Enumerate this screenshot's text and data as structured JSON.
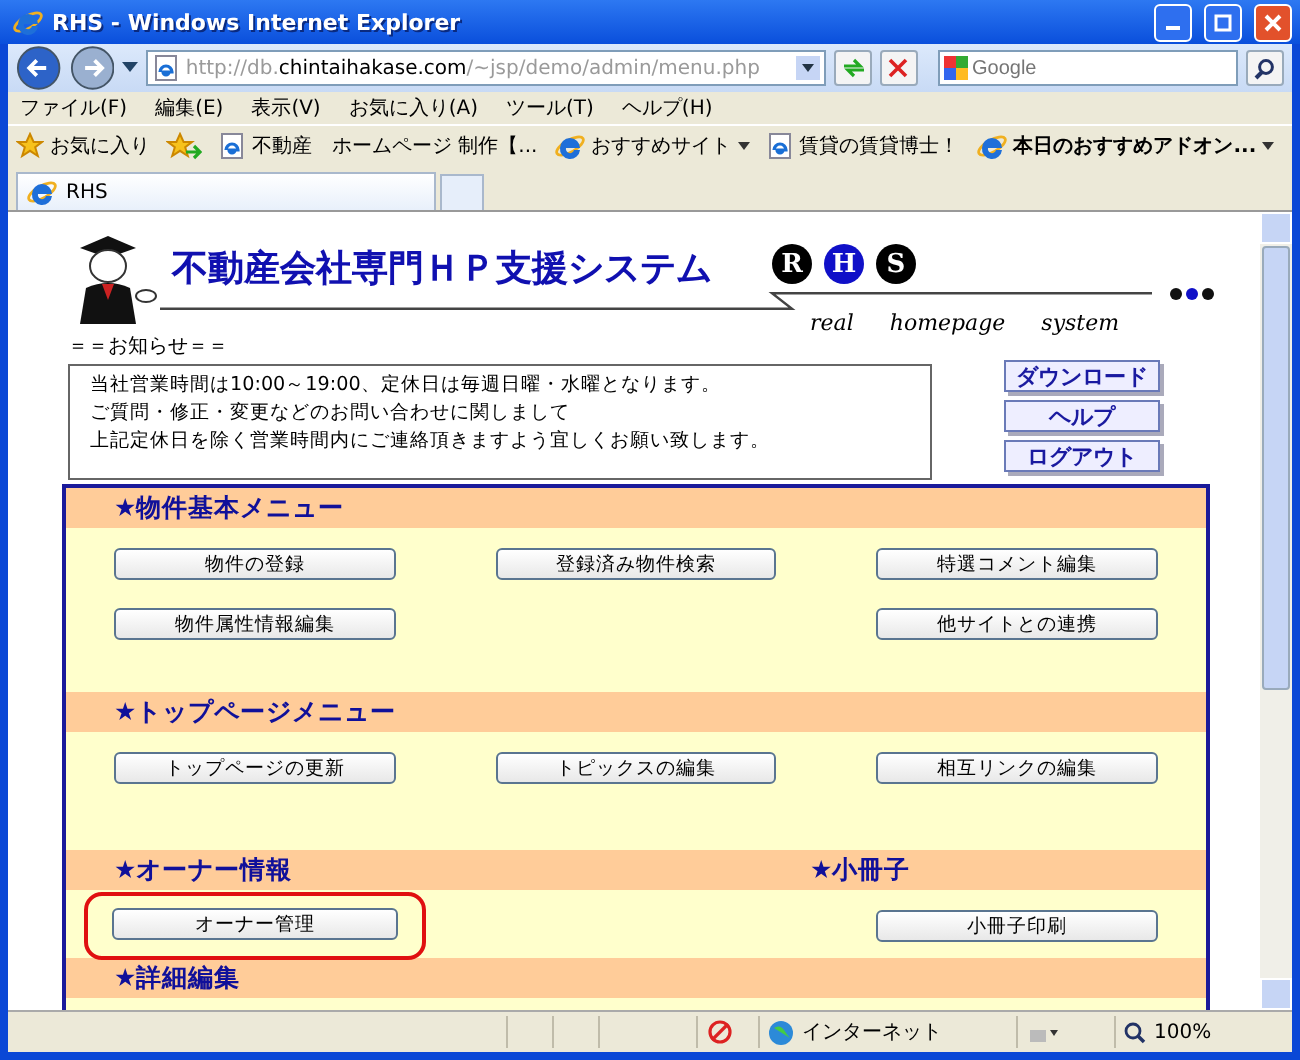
{
  "window": {
    "title": "RHS - Windows Internet Explorer"
  },
  "address_bar": {
    "url": "http://db.**chintaihakase.com**/~jsp/demo/admin/menu.php"
  },
  "search": {
    "placeholder": "Google"
  },
  "menu_bar": [
    "ファイル(F)",
    "編集(E)",
    "表示(V)",
    "お気に入り(A)",
    "ツール(T)",
    "ヘルプ(H)"
  ],
  "favorites_bar": {
    "favorites_button": "お気に入り",
    "links": [
      {
        "label": "不動産　ホームページ 制作【...",
        "kind": "page",
        "bold": false
      },
      {
        "label": "おすすめサイト",
        "kind": "menu",
        "bold": false
      },
      {
        "label": "賃貸の賃貸博士！",
        "kind": "page",
        "bold": false
      },
      {
        "label": "本日のおすすめアドオン...",
        "kind": "menu",
        "bold": true
      }
    ]
  },
  "tabs": [
    {
      "label": "RHS",
      "selected": true
    }
  ],
  "site_header": {
    "title": "不動産会社専門ＨＰ支援システム",
    "logo_letters": [
      {
        "letter": "R",
        "selected": false
      },
      {
        "letter": "H",
        "selected": true
      },
      {
        "letter": "S",
        "selected": false
      }
    ],
    "tagline": [
      "real",
      "homepage",
      "system"
    ]
  },
  "notice": {
    "heading": "＝＝お知らせ＝＝",
    "lines": [
      "当社営業時間は10:00～19:00、定休日は毎週日曜・水曜となります。",
      "ご質問・修正・変更などのお問い合わせに関しまして",
      "上記定休日を除く営業時間内にご連絡頂きますよう宜しくお願い致します。"
    ]
  },
  "side_buttons": [
    "ダウンロード",
    "ヘルプ",
    "ログアウト"
  ],
  "menu_sections": [
    {
      "headings": [
        {
          "kind": "heading",
          "text": "★物件基本メニュー"
        }
      ],
      "button_rows": [
        [
          {
            "kind": "button",
            "label": "物件の登録",
            "highlighted": false
          },
          {
            "kind": "button",
            "label": "登録済み物件検索",
            "highlighted": false
          },
          {
            "kind": "button",
            "label": "特選コメント編集",
            "highlighted": false
          }
        ],
        [
          {
            "kind": "button",
            "label": "物件属性情報編集",
            "highlighted": false
          },
          {
            "kind": "blank"
          },
          {
            "kind": "button",
            "label": "他サイトとの連携",
            "highlighted": false
          }
        ]
      ]
    },
    {
      "headings": [
        {
          "kind": "heading",
          "text": "★トップページメニュー"
        }
      ],
      "button_rows": [
        [
          {
            "kind": "button",
            "label": "トップページの更新",
            "highlighted": false
          },
          {
            "kind": "button",
            "label": "トピックスの編集",
            "highlighted": false
          },
          {
            "kind": "button",
            "label": "相互リンクの編集",
            "highlighted": false
          }
        ]
      ]
    },
    {
      "headings": [
        {
          "kind": "heading",
          "text": "★オーナー情報"
        },
        {
          "kind": "blank"
        },
        {
          "kind": "heading",
          "text": "★小冊子"
        }
      ],
      "button_rows": [
        [
          {
            "kind": "button",
            "label": "オーナー管理",
            "highlighted": true
          },
          {
            "kind": "blank"
          },
          {
            "kind": "button",
            "label": "小冊子印刷",
            "highlighted": false
          }
        ]
      ]
    },
    {
      "headings": [
        {
          "kind": "heading",
          "text": "★詳細編集"
        }
      ]
    }
  ],
  "status_bar": {
    "zone": "インターネット",
    "zoom": "100%"
  }
}
